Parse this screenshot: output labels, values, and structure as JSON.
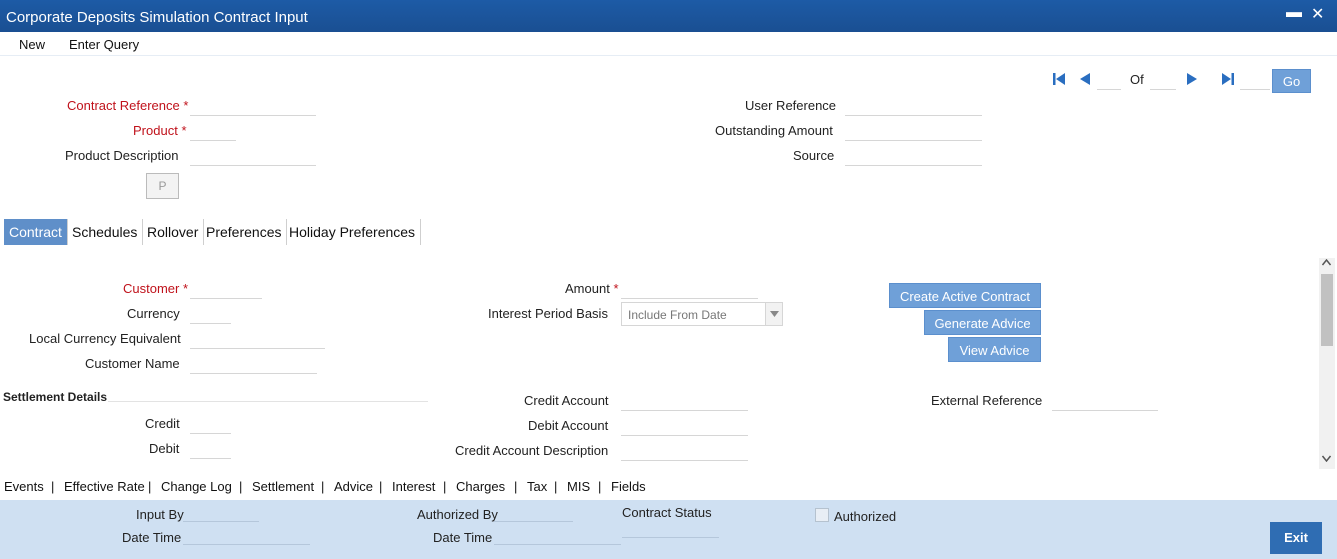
{
  "window": {
    "title": "Corporate Deposits Simulation Contract Input",
    "minimize": "▬",
    "close": "✕"
  },
  "menu": {
    "new": "New",
    "enter_query": "Enter Query"
  },
  "nav": {
    "of": "Of",
    "go": "Go"
  },
  "header": {
    "contract_reference": "Contract Reference",
    "product": "Product",
    "product_description": "Product Description",
    "p_button": "P",
    "user_reference": "User Reference",
    "outstanding_amount": "Outstanding Amount",
    "source": "Source",
    "required_mark": "*"
  },
  "tabs": [
    "Contract",
    "Schedules",
    "Rollover",
    "Preferences",
    "Holiday Preferences"
  ],
  "contract": {
    "customer": "Customer",
    "currency": "Currency",
    "local_currency_equivalent": "Local Currency Equivalent",
    "customer_name": "Customer Name",
    "amount": "Amount",
    "interest_period_basis": "Interest Period Basis",
    "interest_period_basis_value": "Include From Date",
    "create_active_contract": "Create Active Contract",
    "generate_advice": "Generate Advice",
    "view_advice": "View Advice"
  },
  "settlement": {
    "heading": "Settlement Details",
    "credit": "Credit",
    "debit": "Debit",
    "credit_account": "Credit Account",
    "debit_account": "Debit Account",
    "credit_account_description": "Credit Account Description",
    "external_reference": "External Reference"
  },
  "footer_links": [
    "Events",
    "Effective Rate",
    "Change Log",
    "Settlement",
    "Advice",
    "Interest",
    "Charges",
    "Tax",
    "MIS",
    "Fields"
  ],
  "footer": {
    "input_by": "Input By",
    "date_time": "Date Time",
    "authorized_by": "Authorized By",
    "contract_status": "Contract Status",
    "authorized": "Authorized",
    "exit": "Exit"
  },
  "icons": {
    "first": "first-record-icon",
    "prev": "previous-record-icon",
    "next": "next-record-icon",
    "last": "last-record-icon",
    "select_arrow": "dropdown-arrow-icon"
  }
}
